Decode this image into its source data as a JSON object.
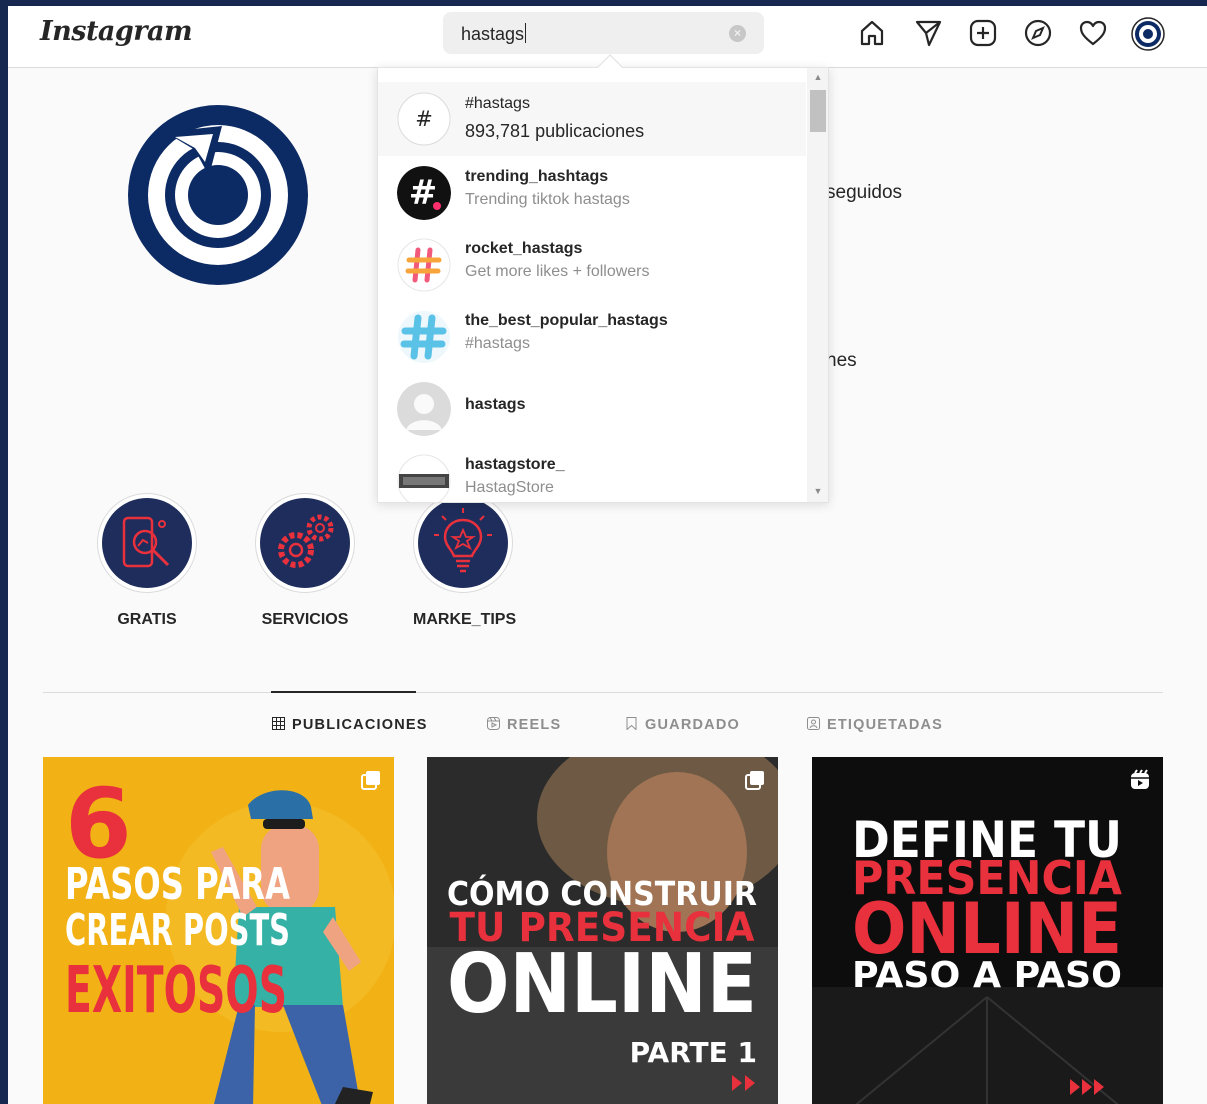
{
  "brand": {
    "logo_text": "Instagram"
  },
  "search": {
    "query": "hastags"
  },
  "nav_icons": [
    "home-icon",
    "direct-icon",
    "new-post-icon",
    "explore-icon",
    "activity-icon",
    "profile-avatar"
  ],
  "dropdown": {
    "items": [
      {
        "name": "#hastags",
        "sub": "893,781 publicaciones",
        "avatar": "hashtag-icon"
      },
      {
        "name": "trending_hashtags",
        "sub": "Trending tiktok hastags",
        "avatar": "trending-hashtags-avatar"
      },
      {
        "name": "rocket_hastags",
        "sub": "Get more likes + followers",
        "avatar": "rocket-hastags-avatar"
      },
      {
        "name": "the_best_popular_hastags",
        "sub": "#hastags",
        "avatar": "best-popular-avatar"
      },
      {
        "name": "hastags",
        "sub": "",
        "avatar": "default-avatar"
      },
      {
        "name": "hastagstore_",
        "sub": "HastagStore",
        "avatar": "hastagstore-avatar"
      }
    ]
  },
  "profile": {
    "peek_following": "seguidos",
    "peek_bio": "nes"
  },
  "highlights": [
    {
      "label": "GRATIS"
    },
    {
      "label": "SERVICIOS"
    },
    {
      "label": "MARKE_TIPS"
    }
  ],
  "tabs": [
    {
      "label": "PUBLICACIONES",
      "active": true
    },
    {
      "label": "REELS",
      "active": false
    },
    {
      "label": "GUARDADO",
      "active": false
    },
    {
      "label": "ETIQUETADAS",
      "active": false
    }
  ],
  "posts": [
    {
      "big_number": "6",
      "line1": "PASOS PARA",
      "line2": "CREAR POSTS",
      "line3": "EXITOSOS",
      "type": "carousel-icon"
    },
    {
      "line1": "CÓMO CONSTRUIR",
      "line2": "TU PRESENCIA",
      "line3": "ONLINE",
      "line4": "PARTE 1",
      "type": "carousel-icon"
    },
    {
      "line1": "DEFINE TU",
      "line2": "PRESENCIA",
      "line3": "ONLINE",
      "line4": "PASO A PASO",
      "type": "reel-icon"
    }
  ],
  "colors": {
    "page_bg": "#16284f",
    "brand_navy": "#0c2a63",
    "accent_red": "#e8313c",
    "post1_bg": "#f2b216"
  }
}
